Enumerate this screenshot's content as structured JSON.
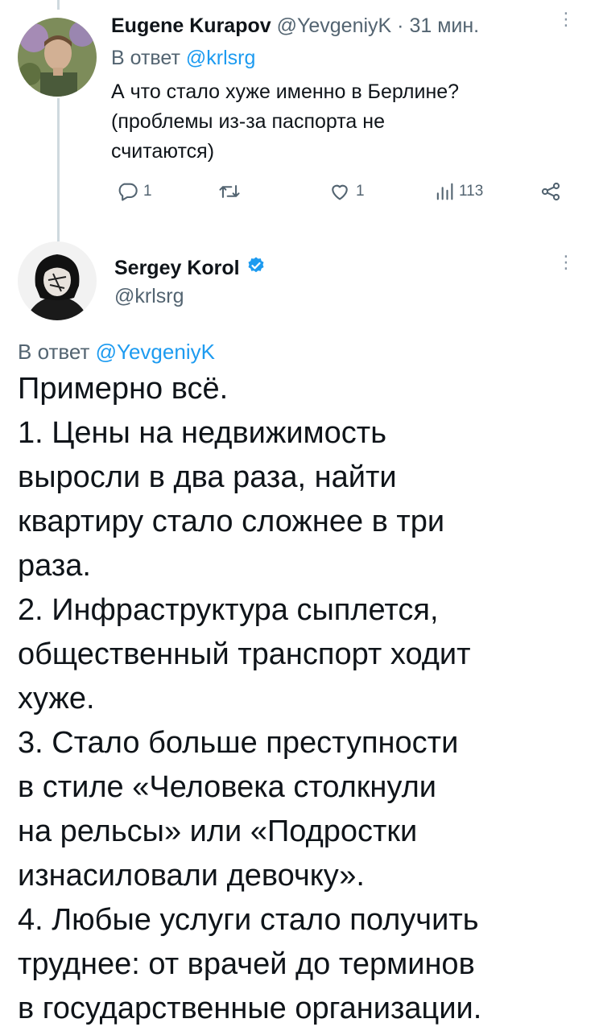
{
  "tweet1": {
    "author_name": "Eugene Kurapov",
    "author_handle": "@YevgeniyK",
    "time": "· 31 мин.",
    "reply_prefix": "В ответ",
    "reply_to": "@krlsrg",
    "text_lines": [
      "А что стало хуже именно в Берлине?",
      "(проблемы из-за паспорта не",
      "считаются)"
    ],
    "actions": {
      "replies": "1",
      "retweets": "",
      "likes": "1",
      "views": "113"
    }
  },
  "tweet2": {
    "author_name": "Sergey Korol",
    "author_handle": "@krlsrg",
    "reply_prefix": "В ответ",
    "reply_to": "@YevgeniyK",
    "text_lines": [
      "Примерно всё.",
      "1. Цены на недвижимость",
      "выросли в два раза, найти",
      "квартиру стало сложнее в три",
      "раза.",
      "2. Инфраструктура сыплется,",
      "общественный транспорт ходит",
      "хуже.",
      "3. Стало больше преступности",
      "в стиле «Человека столкнули",
      "на рельсы» или «Подростки",
      "изнасиловали девочку».",
      "4. Любые услуги стало получить",
      "труднее: от врачей до терминов",
      "в государственные организации."
    ]
  },
  "colors": {
    "accent": "#1d9bf0",
    "muted": "#536471",
    "text": "#0f1419",
    "thread_line": "#cfd9de"
  },
  "icons": [
    "reply-icon",
    "retweet-icon",
    "like-icon",
    "views-icon",
    "share-icon",
    "verified-badge-icon",
    "more-icon"
  ]
}
